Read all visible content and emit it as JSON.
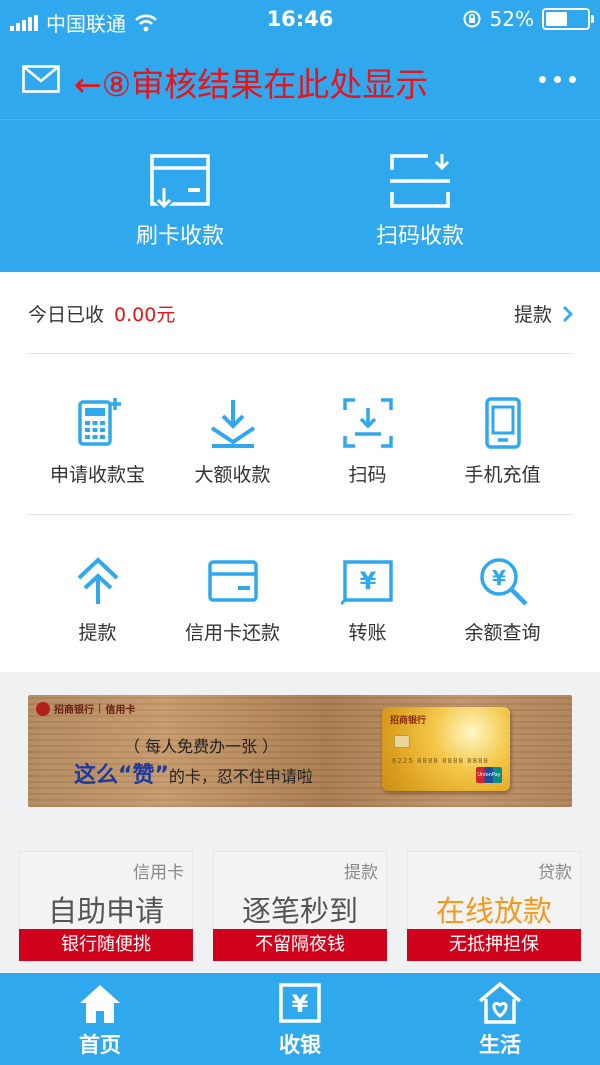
{
  "status_bar": {
    "carrier": "中国联通",
    "time": "16:46",
    "battery": "52%",
    "battery_level": 0.52
  },
  "nav": {
    "annotation": "←⑧审核结果在此处显示"
  },
  "hero": [
    {
      "label": "刷卡收款",
      "icon": "card-swipe-icon"
    },
    {
      "label": "扫码收款",
      "icon": "scan-pay-icon"
    }
  ],
  "summary": {
    "label": "今日已收",
    "amount": "0.00元",
    "withdraw": "提款"
  },
  "grid": [
    {
      "label": "申请收款宝",
      "icon": "pos-terminal-icon"
    },
    {
      "label": "大额收款",
      "icon": "download-tray-icon"
    },
    {
      "label": "扫码",
      "icon": "scan-icon"
    },
    {
      "label": "手机充值",
      "icon": "phone-icon"
    },
    {
      "label": "提款",
      "icon": "up-arrow-icon"
    },
    {
      "label": "信用卡还款",
      "icon": "credit-card-icon"
    },
    {
      "label": "转账",
      "icon": "yuan-transfer-icon"
    },
    {
      "label": "余额查询",
      "icon": "yuan-search-icon"
    }
  ],
  "banner": {
    "bank": "招商银行",
    "sub": "信用卡",
    "line1": "（ 每人免费办一张 ）",
    "line2_highlight": "这么“赞”",
    "line2_rest": "的卡，忍不住申请啦",
    "card_bank": "招商银行",
    "card_number": "6225 8888 8888 8888",
    "card_brand": "UnionPay"
  },
  "promos": [
    {
      "tag": "信用卡",
      "title": "自助申请",
      "strip": "银行随便挑",
      "title_color": "#555555"
    },
    {
      "tag": "提款",
      "title": "逐笔秒到",
      "strip": "不留隔夜钱",
      "title_color": "#555555"
    },
    {
      "tag": "贷款",
      "title": "在线放款",
      "strip": "无抵押担保",
      "title_color": "#f39a1e"
    }
  ],
  "tabs": [
    {
      "label": "首页",
      "icon": "home-icon"
    },
    {
      "label": "收银",
      "icon": "cashier-icon"
    },
    {
      "label": "生活",
      "icon": "life-icon"
    }
  ],
  "colors": {
    "primary": "#2fa8ed",
    "accent_red": "#e8141b",
    "strip_red": "#d0021b",
    "promo_orange": "#f39a1e"
  }
}
